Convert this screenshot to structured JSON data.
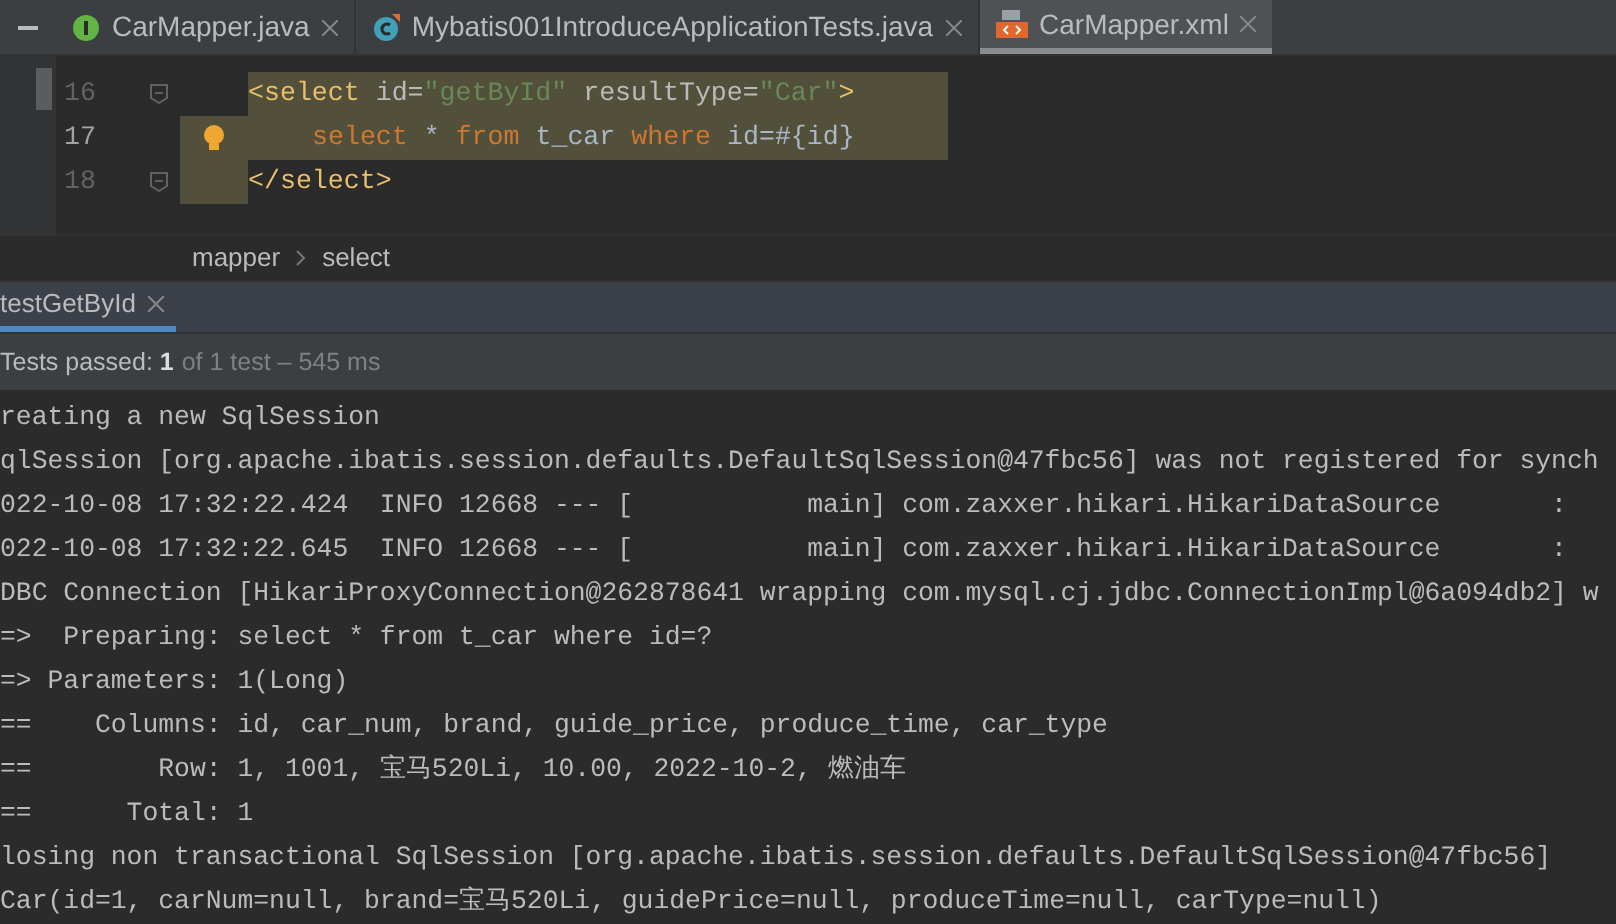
{
  "editor_tabs": [
    {
      "label": "CarMapper.java",
      "kind": "interface",
      "selected": false
    },
    {
      "label": "Mybatis001IntroduceApplicationTests.java",
      "kind": "test-class",
      "selected": false
    },
    {
      "label": "CarMapper.xml",
      "kind": "xml",
      "selected": true
    }
  ],
  "editor": {
    "lines": [
      {
        "number": "16",
        "fold": true,
        "bulb": false,
        "highlighted": true,
        "gutter_highlighted": false,
        "indented": false,
        "tokens": [
          {
            "kind": "tag",
            "text": "<select "
          },
          {
            "kind": "attr",
            "text": "id="
          },
          {
            "kind": "value",
            "text": "\"getById\" "
          },
          {
            "kind": "attr",
            "text": "resultType="
          },
          {
            "kind": "value",
            "text": "\"Car\""
          },
          {
            "kind": "tag",
            "text": ">"
          }
        ]
      },
      {
        "number": "17",
        "fold": false,
        "bulb": true,
        "highlighted": true,
        "gutter_highlighted": true,
        "indented": true,
        "tokens": [
          {
            "kind": "keyword",
            "text": "select "
          },
          {
            "kind": "plain",
            "text": "* "
          },
          {
            "kind": "keyword",
            "text": "from "
          },
          {
            "kind": "plain",
            "text": "t_car "
          },
          {
            "kind": "keyword",
            "text": "where "
          },
          {
            "kind": "plain",
            "text": "id=#{id}"
          }
        ]
      },
      {
        "number": "18",
        "fold": true,
        "bulb": false,
        "highlighted": false,
        "gutter_highlighted": true,
        "indented": false,
        "tokens": [
          {
            "kind": "tag",
            "text": "</select>"
          }
        ]
      }
    ]
  },
  "breadcrumbs": [
    "mapper",
    "select"
  ],
  "run_tabs": [
    {
      "label": "testGetById",
      "selected": true
    }
  ],
  "status": {
    "label": "Tests passed: **1**",
    "detail": "of 1 test – 545 ms"
  },
  "console": [
    "reating a new SqlSession",
    "qlSession [org.apache.ibatis.session.defaults.DefaultSqlSession@47fbc56] was not registered for synch",
    "022-10-08 17:32:22.424  INFO 12668 --- [           main] com.zaxxer.hikari.HikariDataSource       :",
    "022-10-08 17:32:22.645  INFO 12668 --- [           main] com.zaxxer.hikari.HikariDataSource       :",
    "DBC Connection [HikariProxyConnection@262878641 wrapping com.mysql.cj.jdbc.ConnectionImpl@6a094db2] w",
    "=>  Preparing: select * from t_car where id=?",
    "=> Parameters: 1(Long)",
    "==    Columns: id, car_num, brand, guide_price, produce_time, car_type",
    "==        Row: 1, 1001, 宝马520Li, 10.00, 2022-10-2, 燃油车",
    "==      Total: 1",
    "losing non transactional SqlSession [org.apache.ibatis.session.defaults.DefaultSqlSession@47fbc56]",
    "Car(id=1, carNum=null, brand=宝马520Li, guidePrice=null, produceTime=null, carType=null)"
  ]
}
